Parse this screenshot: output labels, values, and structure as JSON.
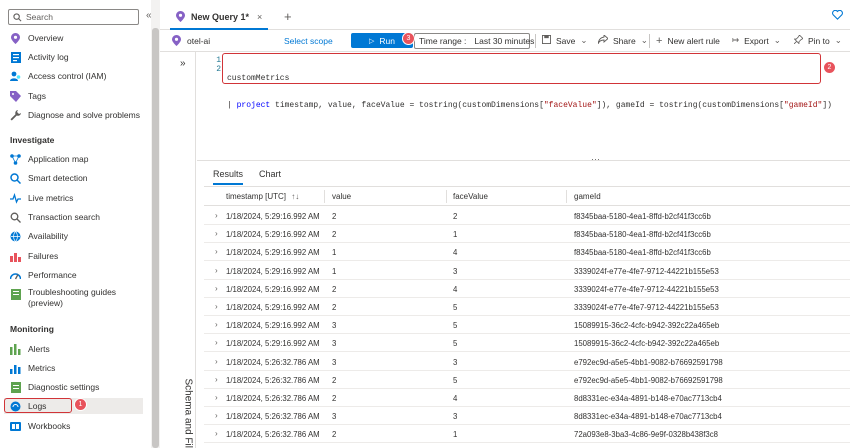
{
  "sidebar": {
    "search_placeholder": "Search",
    "collapse_glyph": "«",
    "items_top": [
      {
        "label": "Overview",
        "icon": "overview-icon"
      },
      {
        "label": "Activity log",
        "icon": "activity-log-icon"
      },
      {
        "label": "Access control (IAM)",
        "icon": "iam-icon"
      },
      {
        "label": "Tags",
        "icon": "tag-icon"
      },
      {
        "label": "Diagnose and solve problems",
        "icon": "wrench-icon"
      }
    ],
    "section_investigate": "Investigate",
    "items_investigate": [
      {
        "label": "Application map",
        "icon": "app-map-icon"
      },
      {
        "label": "Smart detection",
        "icon": "smart-detection-icon"
      },
      {
        "label": "Live metrics",
        "icon": "live-metrics-icon"
      },
      {
        "label": "Transaction search",
        "icon": "search-icon"
      },
      {
        "label": "Availability",
        "icon": "availability-icon"
      },
      {
        "label": "Failures",
        "icon": "failures-icon"
      },
      {
        "label": "Performance",
        "icon": "performance-icon"
      },
      {
        "label": "Troubleshooting guides",
        "label2": "(preview)",
        "icon": "guides-icon"
      }
    ],
    "section_monitoring": "Monitoring",
    "items_monitoring": [
      {
        "label": "Alerts",
        "icon": "alerts-icon"
      },
      {
        "label": "Metrics",
        "icon": "metrics-icon"
      },
      {
        "label": "Diagnostic settings",
        "icon": "diagnostic-settings-icon"
      },
      {
        "label": "Logs",
        "icon": "logs-icon"
      },
      {
        "label": "Workbooks",
        "icon": "workbooks-icon"
      }
    ],
    "logs_badge": "1"
  },
  "tabs": {
    "active_label": "New Query 1*",
    "close_glyph": "×",
    "add_glyph": "+"
  },
  "toolbar": {
    "scope_name": "otel-ai",
    "select_scope": "Select scope",
    "run_label": "Run",
    "run_badge": "3",
    "time_range_label": "Time range :",
    "time_range_value": "Last 30 minutes",
    "save": "Save",
    "share": "Share",
    "new_alert_rule": "New alert rule",
    "export": "Export",
    "pin_to": "Pin to"
  },
  "strip": {
    "expand_glyph": "»",
    "label": "Schema and Filter"
  },
  "editor": {
    "line_numbers": [
      "1",
      "2"
    ],
    "line1": "customMetrics",
    "line2_pipe": "| ",
    "line2_kw": "project",
    "line2_a": " timestamp, value, faceValue = tostring(customDimensions[",
    "line2_s1": "\"faceValue\"",
    "line2_b": "]), gameId = tostring(customDimensions[",
    "line2_s2": "\"gameId\"",
    "line2_c": "])",
    "badge": "2"
  },
  "results": {
    "tabs": [
      "Results",
      "Chart"
    ],
    "columns": [
      "timestamp [UTC]",
      "value",
      "faceValue",
      "gameId"
    ],
    "sort_glyph": "↑↓",
    "rows": [
      [
        "1/18/2024, 5:29:16.992 AM",
        "2",
        "2",
        "f8345baa-5180-4ea1-8ffd-b2cf41f3cc6b"
      ],
      [
        "1/18/2024, 5:29:16.992 AM",
        "2",
        "1",
        "f8345baa-5180-4ea1-8ffd-b2cf41f3cc6b"
      ],
      [
        "1/18/2024, 5:29:16.992 AM",
        "1",
        "4",
        "f8345baa-5180-4ea1-8ffd-b2cf41f3cc6b"
      ],
      [
        "1/18/2024, 5:29:16.992 AM",
        "1",
        "3",
        "3339024f-e77e-4fe7-9712-44221b155e53"
      ],
      [
        "1/18/2024, 5:29:16.992 AM",
        "2",
        "4",
        "3339024f-e77e-4fe7-9712-44221b155e53"
      ],
      [
        "1/18/2024, 5:29:16.992 AM",
        "2",
        "5",
        "3339024f-e77e-4fe7-9712-44221b155e53"
      ],
      [
        "1/18/2024, 5:29:16.992 AM",
        "3",
        "5",
        "15089915-36c2-4cfc-b942-392c22a465eb"
      ],
      [
        "1/18/2024, 5:29:16.992 AM",
        "3",
        "5",
        "15089915-36c2-4cfc-b942-392c22a465eb"
      ],
      [
        "1/18/2024, 5:26:32.786 AM",
        "3",
        "3",
        "e792ec9d-a5e5-4bb1-9082-b76692591798"
      ],
      [
        "1/18/2024, 5:26:32.786 AM",
        "2",
        "5",
        "e792ec9d-a5e5-4bb1-9082-b76692591798"
      ],
      [
        "1/18/2024, 5:26:32.786 AM",
        "2",
        "4",
        "8d8331ec-e34a-4891-b148-e70ac7713cb4"
      ],
      [
        "1/18/2024, 5:26:32.786 AM",
        "3",
        "3",
        "8d8331ec-e34a-4891-b148-e70ac7713cb4"
      ],
      [
        "1/18/2024, 5:26:32.786 AM",
        "2",
        "1",
        "72a093e8-3ba3-4c86-9e9f-0328b438f3c8"
      ],
      [
        "1/18/2024, 5:26:32.786 AM",
        "1",
        "3",
        "72a093e8-3ba3-4c86-9e9f-0328b438f3c8"
      ]
    ]
  },
  "colors": {
    "accent": "#0078d4",
    "highlight": "#d13438",
    "badge": "#e8535c"
  }
}
